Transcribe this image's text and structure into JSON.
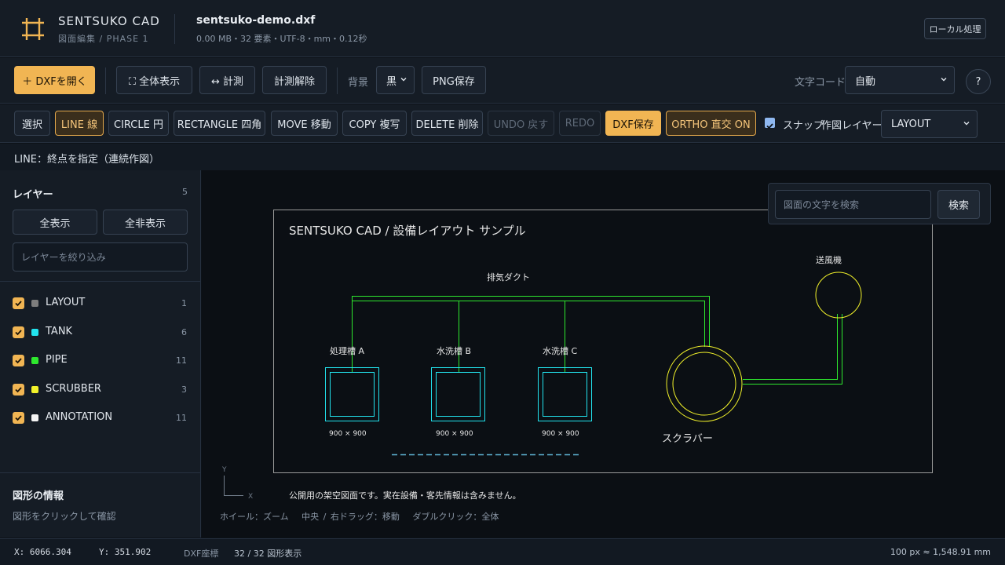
{
  "header": {
    "app_name": "SENTSUKO CAD",
    "app_sub": "図面編集 / PHASE 1",
    "file_name": "sentsuko-demo.dxf",
    "file_meta": "0.00 MB・32 要素・UTF-8・mm・0.12秒",
    "local_label": "ローカル処理"
  },
  "toolbar": {
    "open_label": "＋ DXFを開く",
    "fit_label": "⛶ 全体表示",
    "measure_label": "↔ 計測",
    "clear_measure_label": "計測解除",
    "bg_label": "背景",
    "bg_value": "黒",
    "png_label": "PNG保存",
    "encoding_label": "文字コード",
    "encoding_value": "自動",
    "help_label": "?"
  },
  "tools": {
    "select": "選択",
    "line": "LINE 線",
    "circle": "CIRCLE 円",
    "rectangle": "RECTANGLE 四角",
    "move": "MOVE 移動",
    "copy": "COPY 複写",
    "delete": "DELETE 削除",
    "undo": "UNDO 戻す",
    "redo": "REDO",
    "save": "DXF保存",
    "ortho": "ORTHO 直交 ON",
    "snap_label": "スナップ",
    "snap_checked": true,
    "draw_layer_label": "作図レイヤー",
    "draw_layer_value": "LAYOUT"
  },
  "command_prompt": "LINE：終点を指定（連続作図）",
  "sidebar": {
    "layers_title": "レイヤー",
    "layers_count": "5",
    "show_all": "全表示",
    "hide_all": "全非表示",
    "filter_placeholder": "レイヤーを絞り込み",
    "layers": [
      {
        "name": "LAYOUT",
        "count": "1",
        "color": "#7d7d7d",
        "visible": true
      },
      {
        "name": "TANK",
        "count": "6",
        "color": "#22e3ee",
        "visible": true
      },
      {
        "name": "PIPE",
        "count": "11",
        "color": "#2ee82e",
        "visible": true
      },
      {
        "name": "SCRUBBER",
        "count": "3",
        "color": "#f2f22a",
        "visible": true
      },
      {
        "name": "ANNOTATION",
        "count": "11",
        "color": "#f4f4f4",
        "visible": true
      }
    ],
    "info_title": "図形の情報",
    "info_text": "図形をクリックして確認"
  },
  "canvas": {
    "search_placeholder": "図面の文字を検索",
    "search_button": "検索",
    "drawing_title": "SENTSUKO CAD / 設備レイアウト サンプル",
    "duct_label": "排気ダクト",
    "fan_label": "送風機",
    "tank_a_label": "処理槽 A",
    "tank_b_label": "水洗槽 B",
    "tank_c_label": "水洗槽 C",
    "dim_a": "900 × 900",
    "dim_b": "900 × 900",
    "dim_c": "900 × 900",
    "scrubber_label": "スクラバー",
    "notice": "公開用の架空図面です。実在設備・客先情報は含みません。",
    "axis_y": "Y",
    "axis_x": "X",
    "hint": "ホイール：ズーム　 中央 / 右ドラッグ：移動　 ダブルクリック：全体"
  },
  "status": {
    "x_coord": "X: 6066.304",
    "y_coord": "Y: 351.902",
    "coord_system": "DXF座標",
    "shape_count": "32 / 32 図形表示",
    "scale": "100 px ≈ 1,548.91 mm"
  },
  "colors": {
    "accent": "#f1b553",
    "tank": "#22e3ee",
    "pipe": "#2ee82e",
    "scrubber": "#f2f22a",
    "layout": "#9a9a9a"
  }
}
